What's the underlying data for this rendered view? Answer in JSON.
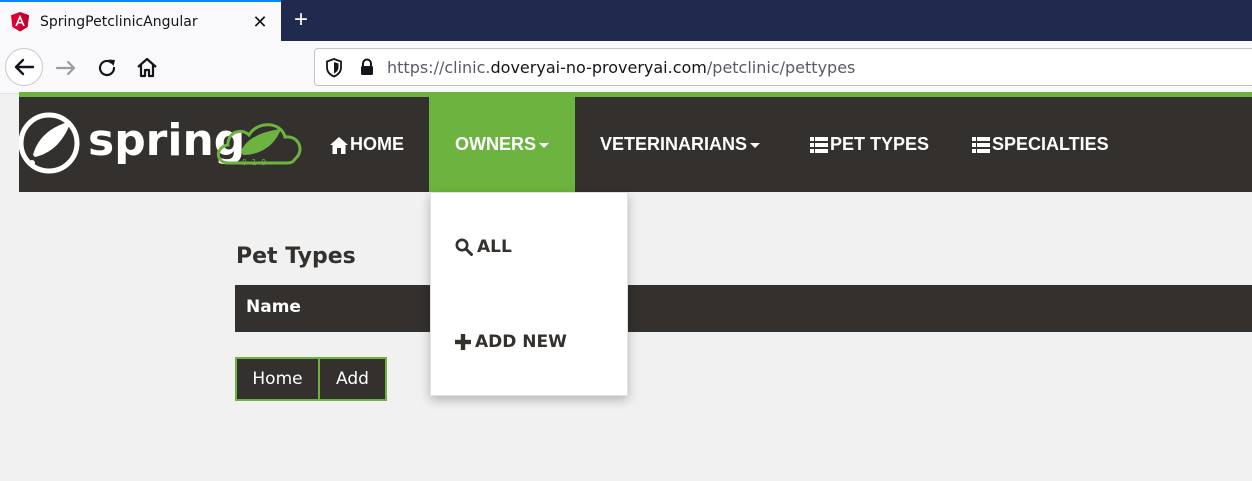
{
  "browser": {
    "tab_title": "SpringPetclinicAngular",
    "url_prefix": "https://clinic.",
    "url_domain": "doveryai-no-proveryai.com",
    "url_path": "/petclinic/pettypes"
  },
  "header": {
    "logo_text": "spring",
    "nav": {
      "home": "HOME",
      "owners": "OWNERS",
      "veterinarians": "VETERINARIANS",
      "pet_types": "PET TYPES",
      "specialties": "SPECIALTIES"
    }
  },
  "owners_menu": {
    "all": "ALL",
    "add_new": "ADD NEW"
  },
  "main": {
    "title": "Pet Types",
    "table": {
      "columns": [
        "Name"
      ]
    },
    "buttons": {
      "home": "Home",
      "add": "Add"
    }
  },
  "colors": {
    "spring_green": "#6db33f",
    "header_dark": "#34302d",
    "page_bg": "#f1f1f1"
  }
}
